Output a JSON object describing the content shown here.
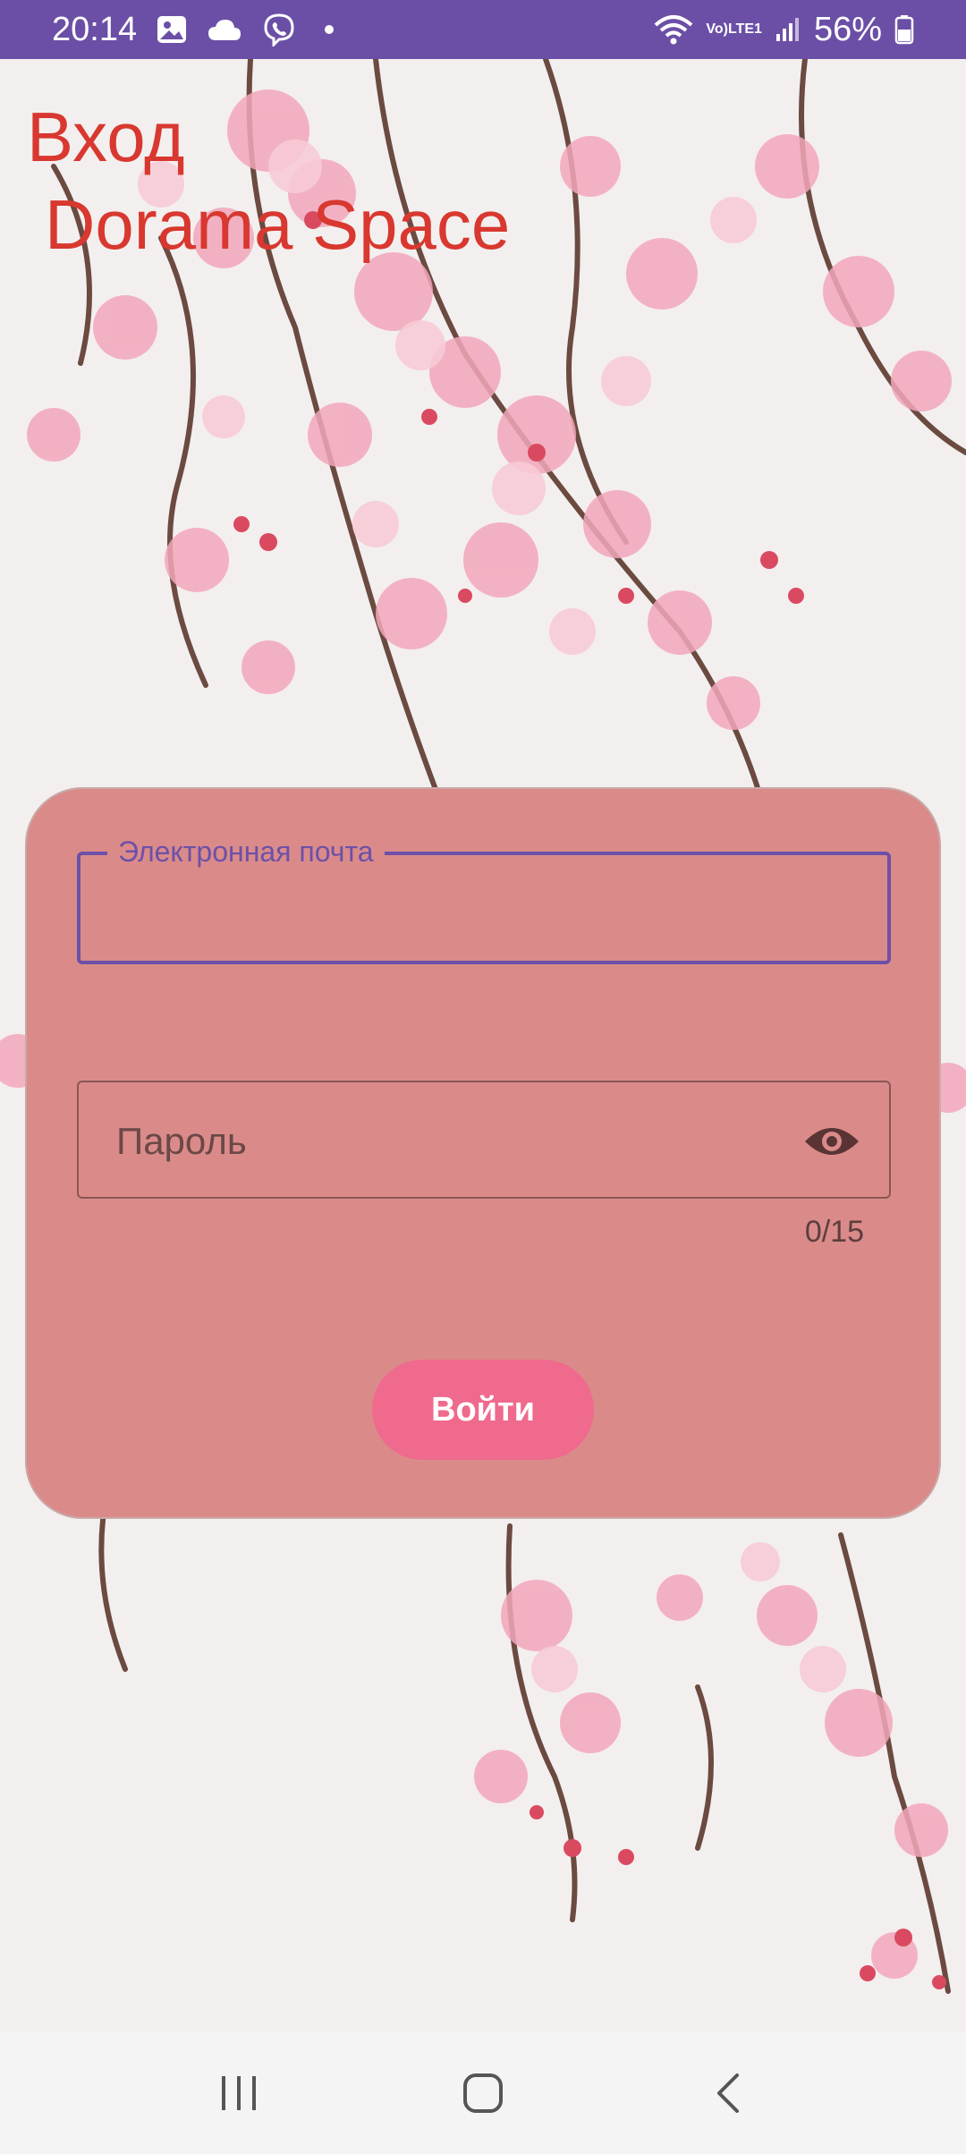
{
  "status_bar": {
    "time": "20:14",
    "battery_percent": "56%",
    "left_icons": [
      "gallery-icon",
      "cloud-icon",
      "viber-icon",
      "notification-dot"
    ],
    "right_icons": [
      "wifi-icon",
      "volte-lte-icon",
      "signal-icon",
      "battery-icon"
    ],
    "volte_line1": "Vo)",
    "volte_line2": "LTE1",
    "color": "#6b4fa6"
  },
  "header": {
    "title_line1": "Вход",
    "title_line2": "Dorama Space",
    "color": "#d8382f"
  },
  "login_form": {
    "email": {
      "label": "Электронная почта",
      "value": "",
      "focused": true
    },
    "password": {
      "placeholder": "Пароль",
      "value": "",
      "counter": "0/15",
      "toggle_icon": "eye-icon"
    },
    "submit_label": "Войти",
    "card_color": "#da8b89",
    "accent_color": "#6d50a8",
    "button_color": "#ef6a8d"
  },
  "nav_bar": {
    "icons": [
      "recent-apps-icon",
      "home-icon",
      "back-icon"
    ]
  }
}
